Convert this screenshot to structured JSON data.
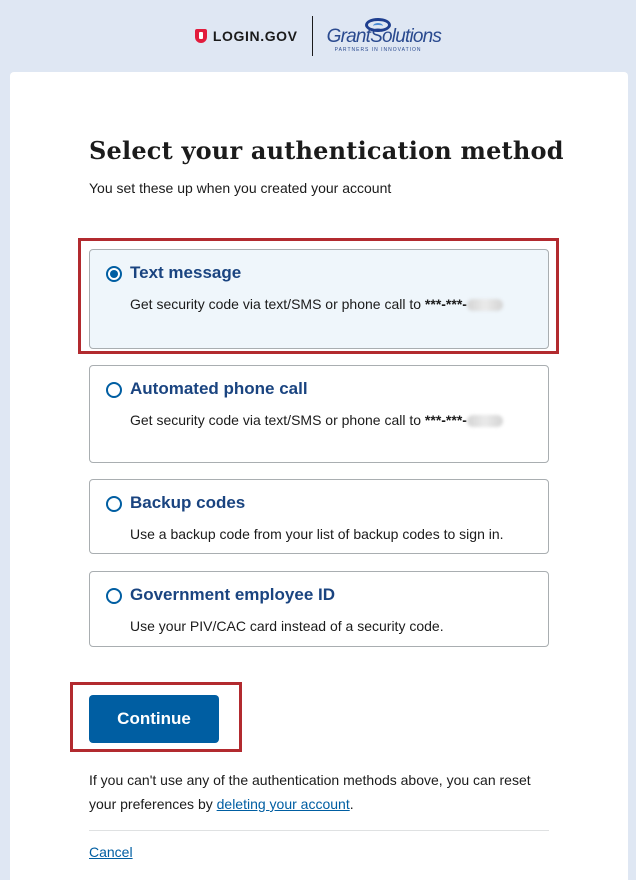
{
  "header": {
    "login_brand": "LOGIN.GOV",
    "partner_name": "GrantSolutions",
    "partner_tagline": "PARTNERS IN INNOVATION"
  },
  "page": {
    "title": "Select your authentication method",
    "subtitle": "You set these up when you created your account"
  },
  "options": [
    {
      "label": "Text message",
      "desc_prefix": "Get security code via text/SMS or phone call to ",
      "masked_phone": "***-***-",
      "selected": true
    },
    {
      "label": "Automated phone call",
      "desc_prefix": "Get security code via text/SMS or phone call to ",
      "masked_phone": "***-***-",
      "selected": false
    },
    {
      "label": "Backup codes",
      "desc": "Use a backup code from your list of backup codes to sign in.",
      "selected": false
    },
    {
      "label": "Government employee ID",
      "desc": "Use your PIV/CAC card instead of a security code.",
      "selected": false
    }
  ],
  "continue_label": "Continue",
  "help": {
    "text": "If you can't use any of the authentication methods above, you can reset your preferences by ",
    "link": "deleting your account",
    "suffix": "."
  },
  "cancel_label": "Cancel",
  "colors": {
    "page_bg": "#dfe7f3",
    "primary": "#005ea2",
    "option_title": "#1a4480",
    "highlight_outline": "#b22a2f"
  }
}
